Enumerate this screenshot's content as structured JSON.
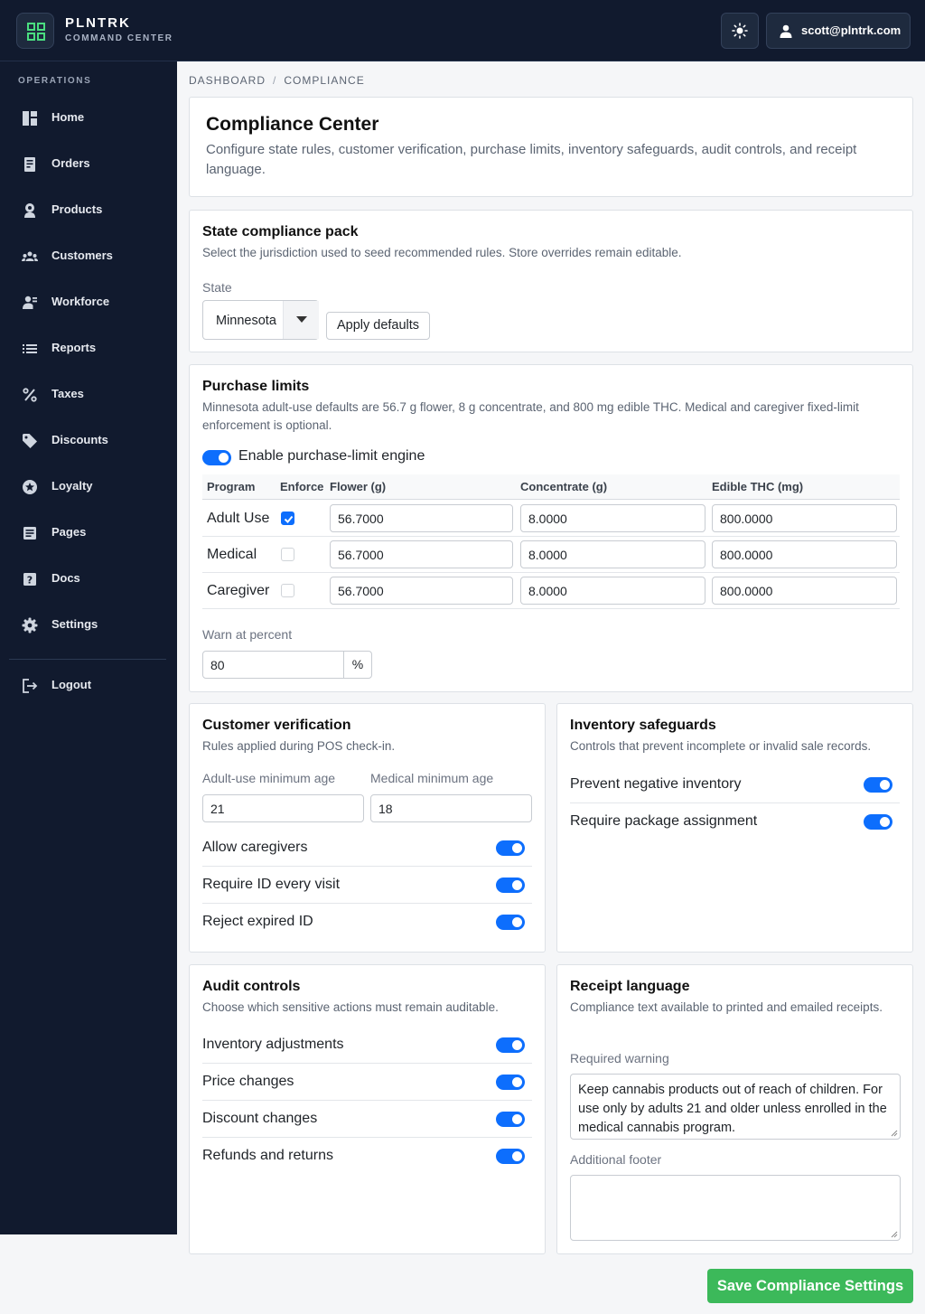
{
  "app": {
    "brand": "PLNTRK",
    "brand_sub": "COMMAND CENTER",
    "user_email": "scott@plntrk.com"
  },
  "sidebar": {
    "section": "OPERATIONS",
    "items": [
      {
        "label": "Home",
        "icon": "home-icon"
      },
      {
        "label": "Orders",
        "icon": "orders-icon"
      },
      {
        "label": "Products",
        "icon": "products-icon"
      },
      {
        "label": "Customers",
        "icon": "customers-icon"
      },
      {
        "label": "Workforce",
        "icon": "workforce-icon"
      },
      {
        "label": "Reports",
        "icon": "reports-icon"
      },
      {
        "label": "Taxes",
        "icon": "percent-icon"
      },
      {
        "label": "Discounts",
        "icon": "tag-icon"
      },
      {
        "label": "Loyalty",
        "icon": "star-icon"
      },
      {
        "label": "Pages",
        "icon": "pages-icon"
      },
      {
        "label": "Docs",
        "icon": "help-icon"
      },
      {
        "label": "Settings",
        "icon": "gear-icon"
      }
    ],
    "logout": "Logout"
  },
  "breadcrumb": {
    "root": "DASHBOARD",
    "sep": "/",
    "current": "COMPLIANCE"
  },
  "header": {
    "title": "Compliance Center",
    "subtitle": "Configure state rules, customer verification, purchase limits, inventory safeguards, audit controls, and receipt language."
  },
  "state_pack": {
    "title": "State compliance pack",
    "subtitle": "Select the jurisdiction used to seed recommended rules. Store overrides remain editable.",
    "state_label": "State",
    "state_value": "Minnesota",
    "apply_label": "Apply defaults"
  },
  "purchase_limits": {
    "title": "Purchase limits",
    "subtitle": "Minnesota adult-use defaults are 56.7 g flower, 8 g concentrate, and 800 mg edible THC. Medical and caregiver fixed-limit enforcement is optional.",
    "engine_label": "Enable purchase-limit engine",
    "engine_enabled": true,
    "headers": {
      "program": "Program",
      "enforce": "Enforce",
      "flower": "Flower (g)",
      "concentrate": "Concentrate (g)",
      "edible": "Edible THC (mg)"
    },
    "rows": [
      {
        "program": "Adult Use",
        "enforce": true,
        "flower": "56.7000",
        "concentrate": "8.0000",
        "edible": "800.0000"
      },
      {
        "program": "Medical",
        "enforce": false,
        "flower": "56.7000",
        "concentrate": "8.0000",
        "edible": "800.0000"
      },
      {
        "program": "Caregiver",
        "enforce": false,
        "flower": "56.7000",
        "concentrate": "8.0000",
        "edible": "800.0000"
      }
    ],
    "warn_label": "Warn at percent",
    "warn_value": "80",
    "warn_unit": "%"
  },
  "customer_verification": {
    "title": "Customer verification",
    "subtitle": "Rules applied during POS check-in.",
    "adult_age_label": "Adult-use minimum age",
    "adult_age": "21",
    "medical_age_label": "Medical minimum age",
    "medical_age": "18",
    "toggles": [
      {
        "label": "Allow caregivers",
        "on": true
      },
      {
        "label": "Require ID every visit",
        "on": true
      },
      {
        "label": "Reject expired ID",
        "on": true
      }
    ]
  },
  "inventory_safeguards": {
    "title": "Inventory safeguards",
    "subtitle": "Controls that prevent incomplete or invalid sale records.",
    "toggles": [
      {
        "label": "Prevent negative inventory",
        "on": true
      },
      {
        "label": "Require package assignment",
        "on": true
      }
    ]
  },
  "audit_controls": {
    "title": "Audit controls",
    "subtitle": "Choose which sensitive actions must remain auditable.",
    "toggles": [
      {
        "label": "Inventory adjustments",
        "on": true
      },
      {
        "label": "Price changes",
        "on": true
      },
      {
        "label": "Discount changes",
        "on": true
      },
      {
        "label": "Refunds and returns",
        "on": true
      }
    ]
  },
  "receipt_language": {
    "title": "Receipt language",
    "subtitle": "Compliance text available to printed and emailed receipts.",
    "warning_label": "Required warning",
    "warning_text": "Keep cannabis products out of reach of children. For use only by adults 21 and older unless enrolled in the medical cannabis program.",
    "footer_label": "Additional footer",
    "footer_text": ""
  },
  "save_label": "Save Compliance Settings",
  "colors": {
    "sidebar": "#111a2e",
    "accent": "#0d6efd",
    "save": "#3cb95a",
    "logo": "#4ade80"
  }
}
